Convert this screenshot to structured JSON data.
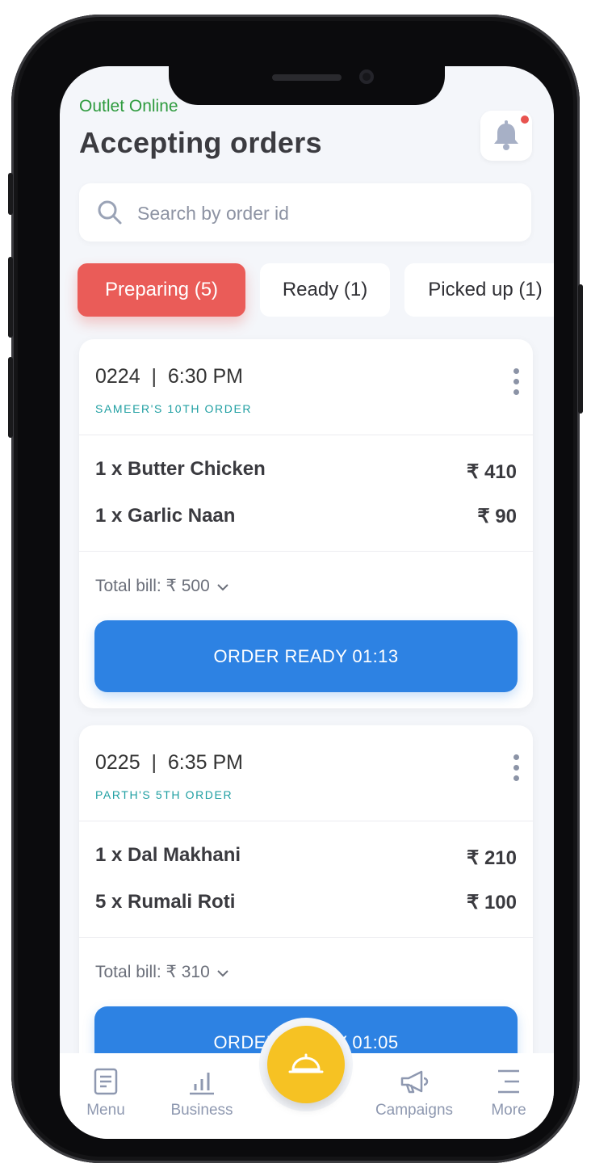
{
  "header": {
    "status": "Outlet Online",
    "title": "Accepting orders"
  },
  "search": {
    "placeholder": "Search by order id"
  },
  "tabs": [
    {
      "label": "Preparing (5)",
      "active": true
    },
    {
      "label": "Ready (1)",
      "active": false
    },
    {
      "label": "Picked up (1)",
      "active": false
    }
  ],
  "orders": [
    {
      "id": "0224",
      "time": "6:30 PM",
      "header": "0224  |  6:30 PM",
      "subtitle": "SAMEER'S 10TH ORDER",
      "items": [
        {
          "name": "1 x Butter Chicken",
          "price": "₹ 410"
        },
        {
          "name": "1 x Garlic Naan",
          "price": "₹ 90"
        }
      ],
      "total": "Total bill: ₹ 500",
      "action": "ORDER READY 01:13"
    },
    {
      "id": "0225",
      "time": "6:35 PM",
      "header": "0225  |  6:35 PM",
      "subtitle": "PARTH'S 5TH ORDER",
      "items": [
        {
          "name": "1 x Dal Makhani",
          "price": "₹ 210"
        },
        {
          "name": "5 x Rumali Roti",
          "price": "₹ 100"
        }
      ],
      "total": "Total bill: ₹ 310",
      "action": "ORDER READY 01:05"
    }
  ],
  "nav": [
    {
      "label": "Menu",
      "icon": "menu-book-icon"
    },
    {
      "label": "Business",
      "icon": "bar-chart-icon"
    },
    {
      "label": "",
      "icon": "cloche-icon"
    },
    {
      "label": "Campaigns",
      "icon": "megaphone-icon"
    },
    {
      "label": "More",
      "icon": "hamburger-icon"
    }
  ],
  "colors": {
    "online": "#2e9b3e",
    "active_tab": "#ea5c58",
    "primary_button": "#2d82e3",
    "fab": "#f6c223",
    "notification_dot": "#e8534f",
    "order_subtitle": "#1f9fa2"
  }
}
